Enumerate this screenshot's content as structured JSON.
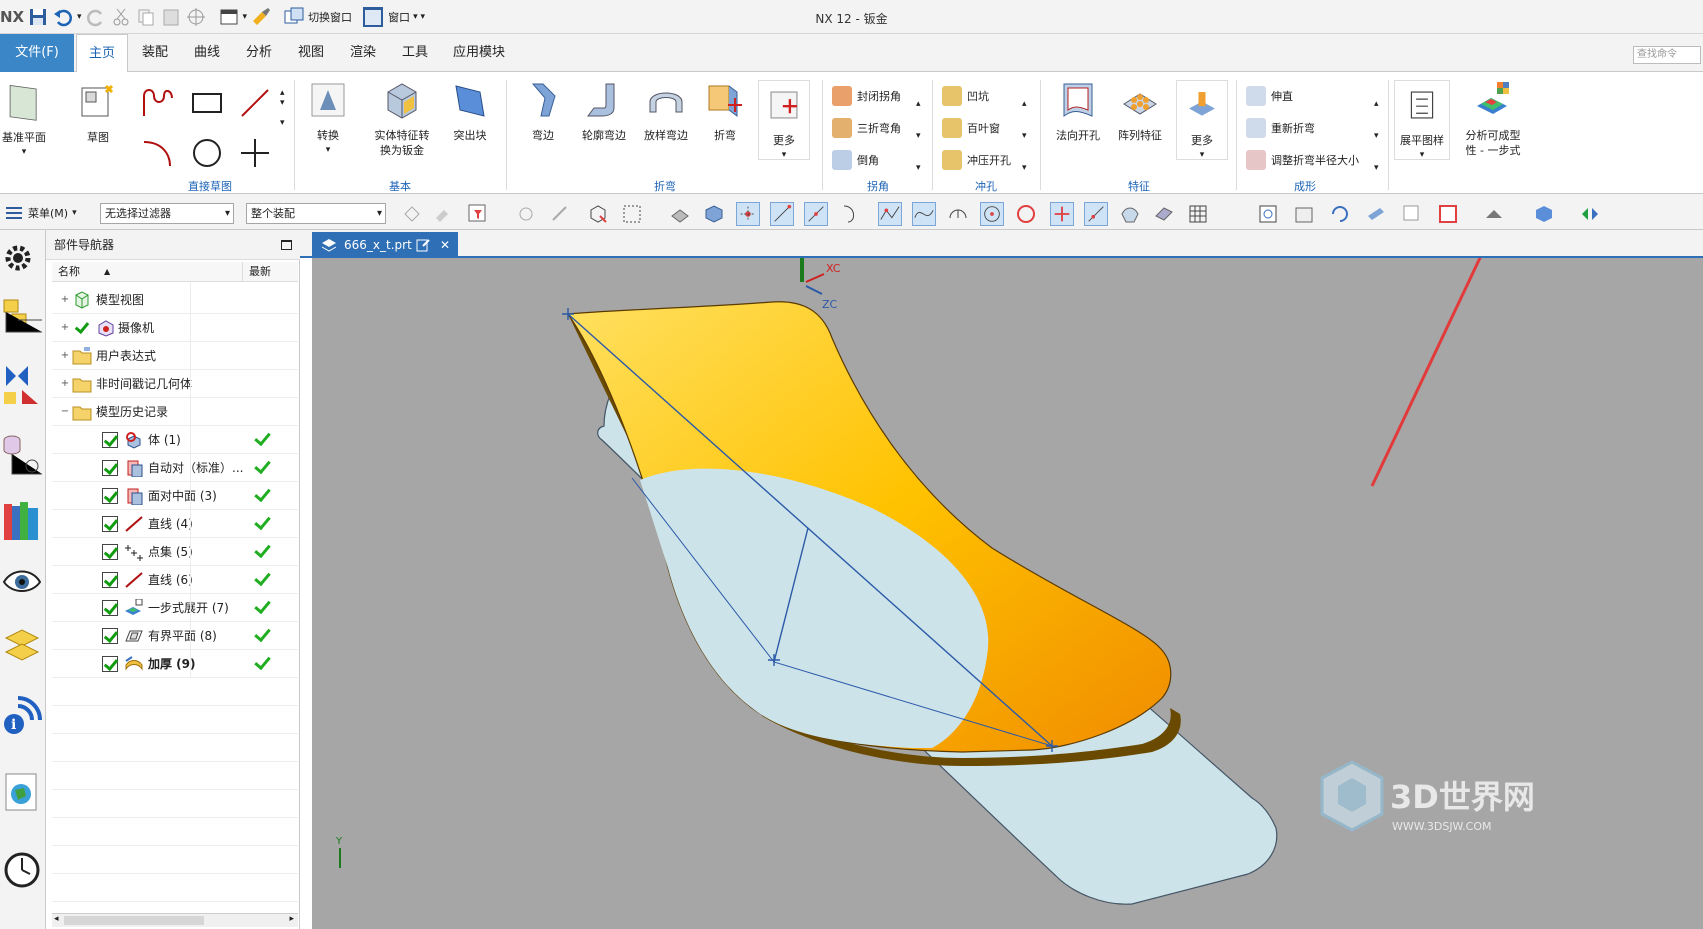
{
  "titlebar": {
    "app_logo": "NX",
    "title": "NX 12 - 钣金",
    "switch_window": "切换窗口",
    "window": "窗口"
  },
  "menu": {
    "file": "文件(F)",
    "tabs": [
      "主页",
      "装配",
      "曲线",
      "分析",
      "视图",
      "渲染",
      "工具",
      "应用模块"
    ],
    "search_placeholder": "查找命令"
  },
  "ribbon": {
    "datum_plane": "基准平面",
    "sketch": "草图",
    "direct_sketch_group": "直接草图",
    "convert": "转换",
    "solid_to_sheet": "实体特征转\n换为钣金",
    "tab": "突出块",
    "basic_group": "基本",
    "flange": "弯边",
    "contour_flange": "轮廓弯边",
    "lofted_flange": "放样弯边",
    "bend": "折弯",
    "more_bend": "更多",
    "bend_group": "折弯",
    "closed_corner": "封闭拐角",
    "three_bend_corner": "三折弯角",
    "chamfer": "倒角",
    "corner_group": "拐角",
    "dimple": "凹坑",
    "louver": "百叶窗",
    "drawn_cutout": "冲压开孔",
    "punch_group": "冲孔",
    "normal_cutout": "法向开孔",
    "pattern_feature": "阵列特征",
    "more_feature": "更多",
    "feature_group": "特征",
    "unbend": "伸直",
    "rebend": "重新折弯",
    "resize_bend_radius": "调整折弯半径大小",
    "form_group": "成形",
    "flat_pattern": "展平图样",
    "formability": "分析可成型\n性 - 一步式"
  },
  "toolbar2": {
    "menu": "菜单(M)",
    "filter": "无选择过滤器",
    "scope": "整个装配"
  },
  "navigator": {
    "title": "部件导航器",
    "col_name": "名称",
    "col_latest": "最新",
    "rows": [
      {
        "label": "模型视图"
      },
      {
        "label": "摄像机"
      },
      {
        "label": "用户表达式"
      },
      {
        "label": "非时间戳记几何体"
      },
      {
        "label": "模型历史记录"
      },
      {
        "label": "体 (1)"
      },
      {
        "label": "自动对（标准）..."
      },
      {
        "label": "面对中面 (3)"
      },
      {
        "label": "直线 (4)"
      },
      {
        "label": "点集 (5)"
      },
      {
        "label": "直线 (6)"
      },
      {
        "label": "一步式展开 (7)"
      },
      {
        "label": "有界平面 (8)"
      },
      {
        "label": "加厚 (9)"
      }
    ]
  },
  "viewport": {
    "tab": "666_x_t.prt",
    "axis_x": "XC",
    "axis_z": "ZC",
    "axis_y": "Y",
    "watermark": "3D世界网",
    "watermark_url": "WWW.3DSJW.COM"
  },
  "colors": {
    "accent": "#1c63b6",
    "file_tab": "#3b86c6",
    "viewport_bg": "#a6a6a6",
    "part_yellow": "#ffc000",
    "flat_blue": "#cde3ea",
    "arrow_red": "#e23a3a"
  }
}
